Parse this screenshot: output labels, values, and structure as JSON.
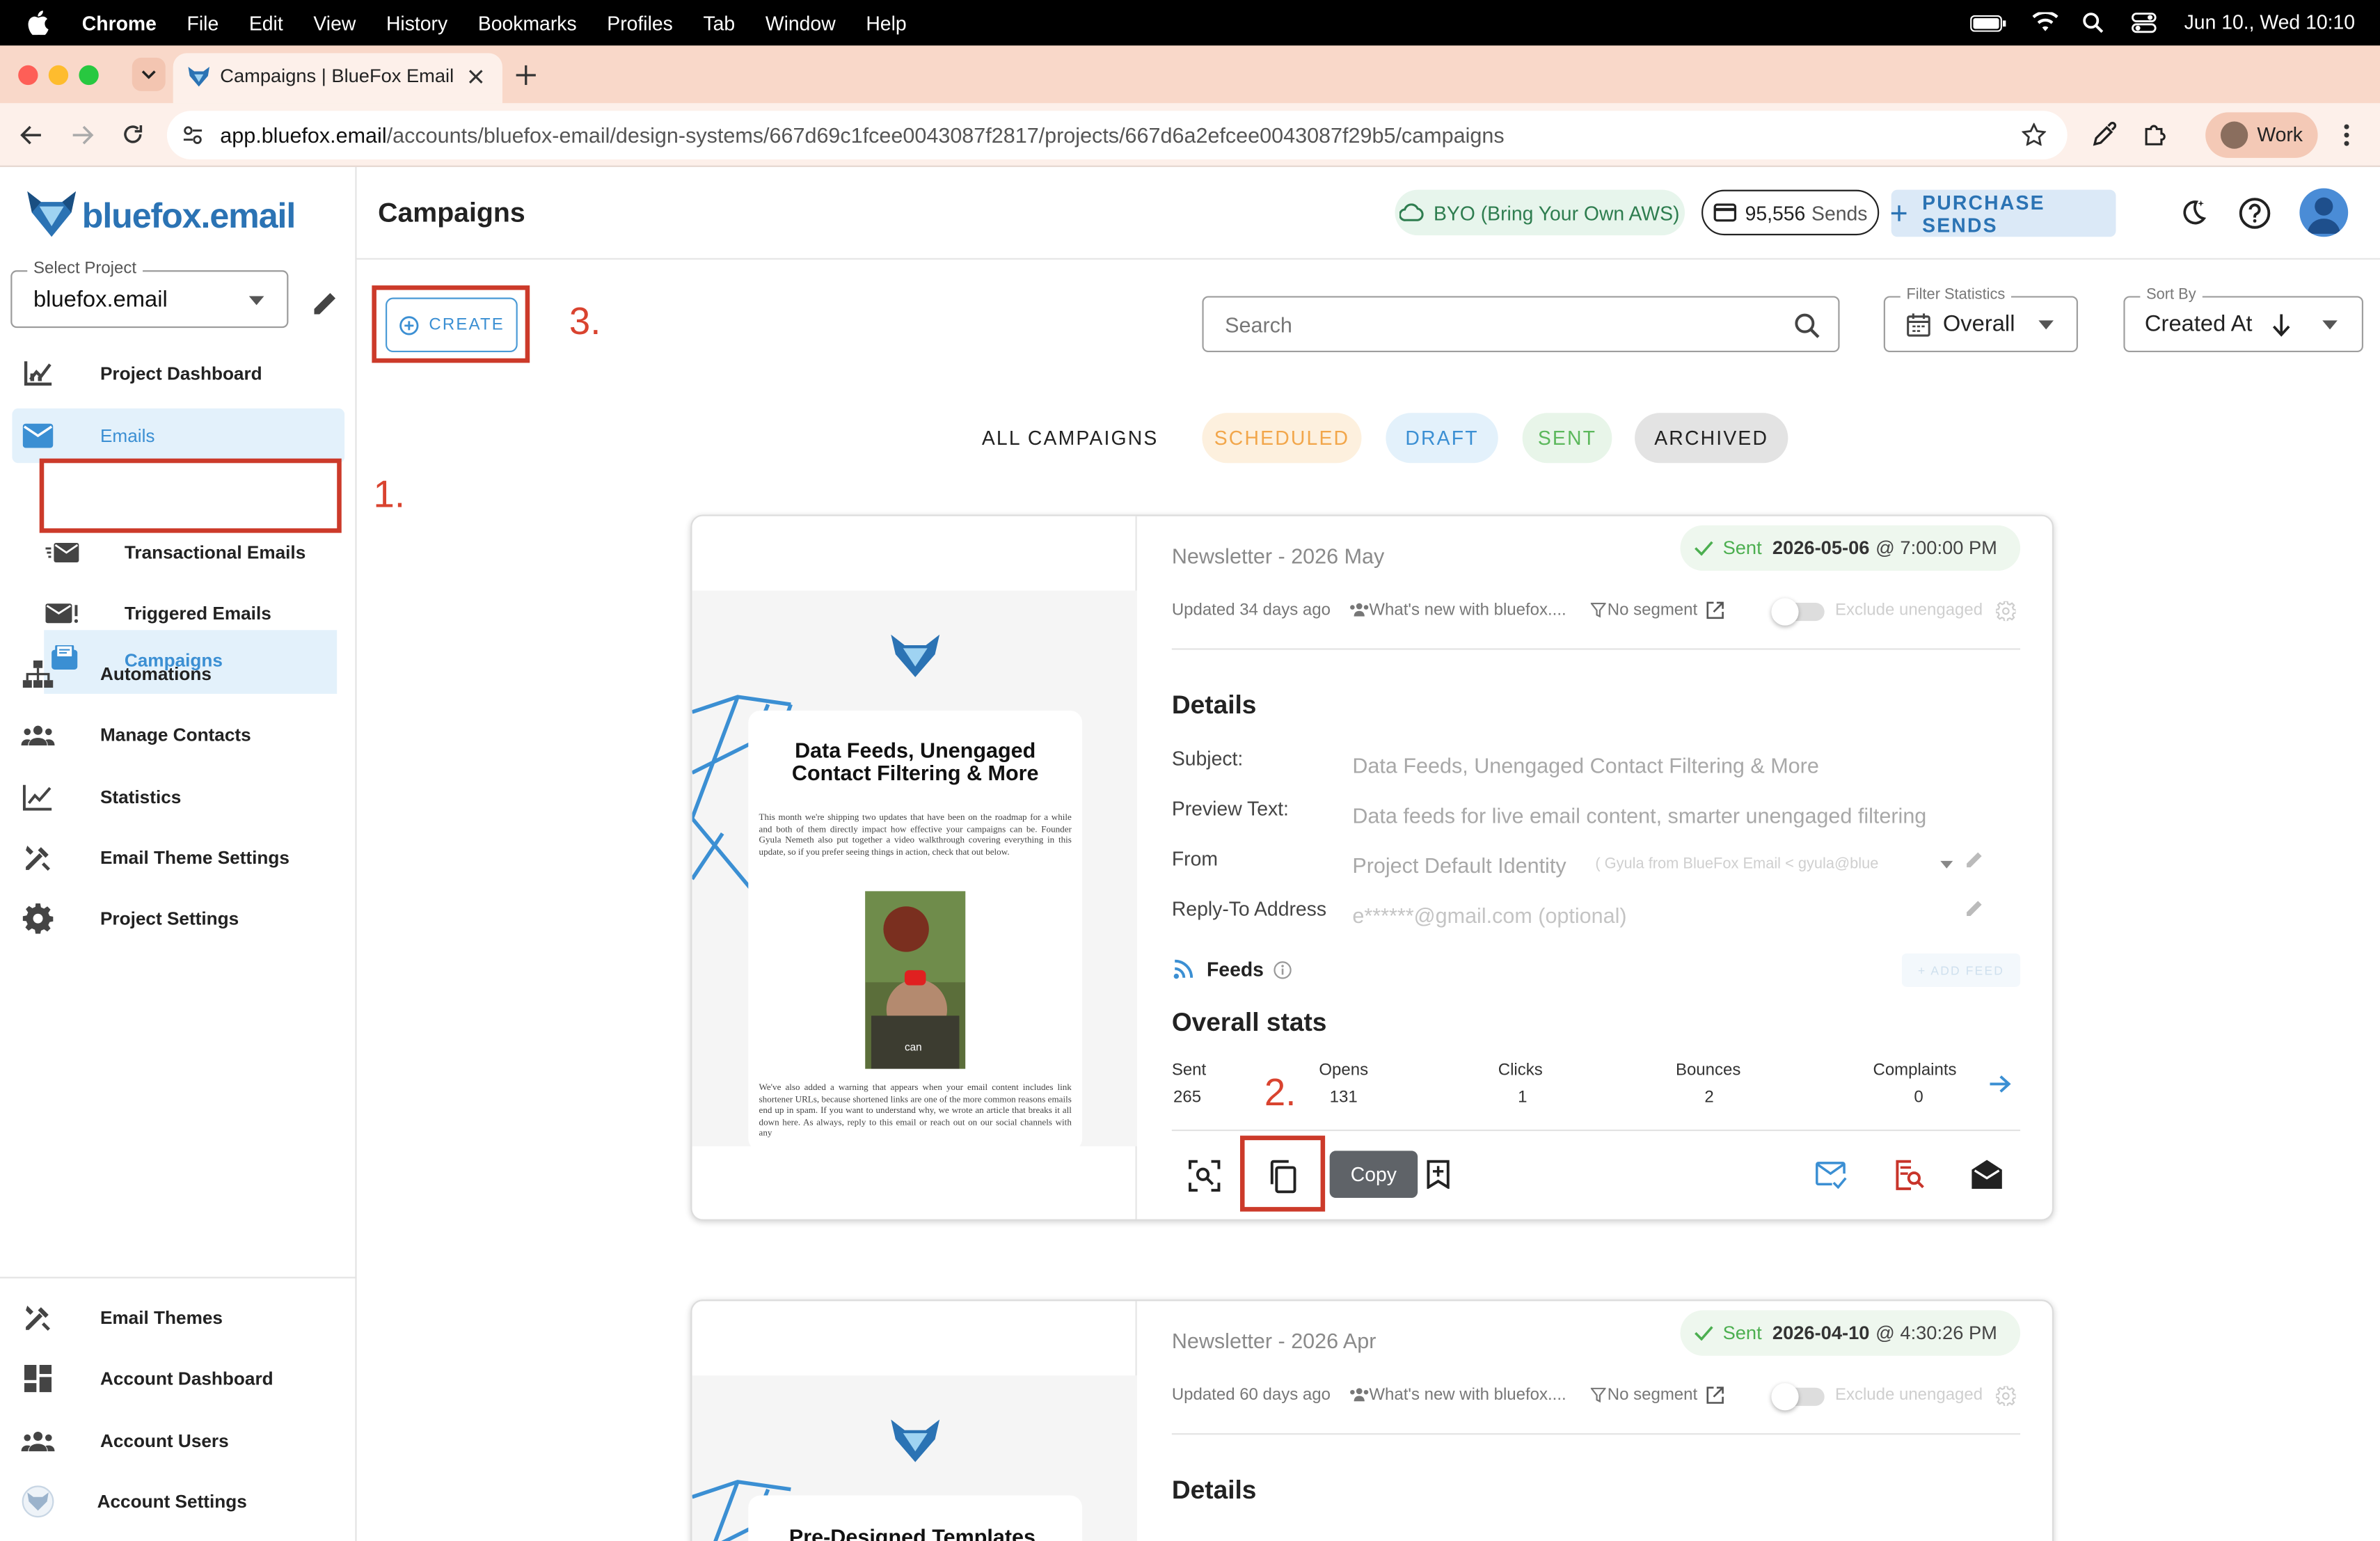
{
  "menubar": {
    "app": "Chrome",
    "items": [
      "File",
      "Edit",
      "View",
      "History",
      "Bookmarks",
      "Profiles",
      "Tab",
      "Window",
      "Help"
    ],
    "datetime": "Jun 10., Wed  10:10"
  },
  "browser": {
    "tab_title": "Campaigns | BlueFox Email",
    "url_host": "app.bluefox.email",
    "url_path": "/accounts/bluefox-email/design-systems/667d69c1fcee0043087f2817/projects/667d6a2efcee0043087f29b5/campaigns",
    "profile": "Work"
  },
  "brand": {
    "name": "bluefox.email",
    "accent": "#2b73b4"
  },
  "sidebar": {
    "project_label": "Select Project",
    "project_value": "bluefox.email",
    "items": [
      {
        "label": "Project Dashboard",
        "icon": "chart-icon"
      },
      {
        "label": "Emails",
        "icon": "mail-icon"
      },
      {
        "label": "Campaigns",
        "icon": "campaign-icon"
      },
      {
        "label": "Transactional Emails",
        "icon": "fast-mail-icon"
      },
      {
        "label": "Triggered Emails",
        "icon": "mail-alert-icon"
      },
      {
        "label": "Automations",
        "icon": "sitemap-icon"
      },
      {
        "label": "Manage Contacts",
        "icon": "group-icon"
      },
      {
        "label": "Statistics",
        "icon": "line-chart-icon"
      },
      {
        "label": "Email Theme Settings",
        "icon": "tools-icon"
      },
      {
        "label": "Project Settings",
        "icon": "gear-icon"
      }
    ],
    "bottom_items": [
      {
        "label": "Email Themes",
        "icon": "tools-icon"
      },
      {
        "label": "Account Dashboard",
        "icon": "dashboard-icon"
      },
      {
        "label": "Account Users",
        "icon": "group-icon"
      },
      {
        "label": "Account Settings",
        "icon": "fox-icon"
      }
    ]
  },
  "header": {
    "title": "Campaigns",
    "byo": "BYO (Bring Your Own AWS)",
    "sends_count": "95,556",
    "sends_label": "Sends",
    "purchase": "PURCHASE SENDS"
  },
  "toolbar": {
    "create": "CREATE",
    "search_placeholder": "Search",
    "filter_label": "Filter Statistics",
    "filter_value": "Overall",
    "sort_label": "Sort By",
    "sort_value": "Created At"
  },
  "filters": [
    "ALL CAMPAIGNS",
    "SCHEDULED",
    "DRAFT",
    "SENT",
    "ARCHIVED"
  ],
  "annotations": {
    "step1": "1.",
    "step2": "2.",
    "step3": "3."
  },
  "campaigns": [
    {
      "name": "Newsletter - 2026 May",
      "status": "Sent",
      "date": "2026-05-06",
      "time": "@ 7:00:00 PM",
      "updated": "Updated 34 days ago",
      "list": "What's new with bluefox....",
      "segment": "No segment",
      "exclude": "Exclude unengaged",
      "details_title": "Details",
      "subject_label": "Subject:",
      "subject": "Data Feeds, Unengaged Contact Filtering & More",
      "preview_label": "Preview Text:",
      "preview": "Data feeds for live email content, smarter unengaged filtering",
      "from_label": "From",
      "from": "Project Default Identity",
      "from_detail": "( Gyula from BlueFox Email < gyula@blue",
      "reply_label": "Reply-To Address",
      "reply": "e******@gmail.com (optional)",
      "feeds": "Feeds",
      "add_feed": "+ ADD FEED",
      "stats_title": "Overall stats",
      "stats": [
        {
          "label": "Sent",
          "value": "265"
        },
        {
          "label": "Opens",
          "value": "131"
        },
        {
          "label": "Clicks",
          "value": "1"
        },
        {
          "label": "Bounces",
          "value": "2"
        },
        {
          "label": "Complaints",
          "value": "0"
        }
      ],
      "tooltip": "Copy",
      "thumb_title": "Data Feeds, Unengaged Contact Filtering & More",
      "thumb_body1": "This month we're shipping two updates that have been on the roadmap for a while and both of them directly impact how effective your campaigns can be. Founder Gyula Nemeth also put together a video walkthrough covering everything in this update, so if you prefer seeing things in action, check that out below.",
      "thumb_caption": "can",
      "thumb_body2": "We've also added a warning that appears when your email content includes link shortener URLs, because shortened links are one of the more common reasons emails end up in spam. If you want to understand why, we wrote an article that breaks it all down here. As always, reply to this email or reach out on our social channels with any"
    },
    {
      "name": "Newsletter - 2026 Apr",
      "status": "Sent",
      "date": "2026-04-10",
      "time": "@ 4:30:26 PM",
      "updated": "Updated 60 days ago",
      "list": "What's new with bluefox....",
      "segment": "No segment",
      "exclude": "Exclude unengaged",
      "details_title": "Details",
      "thumb_title": "Pre-Designed Templates,"
    }
  ]
}
